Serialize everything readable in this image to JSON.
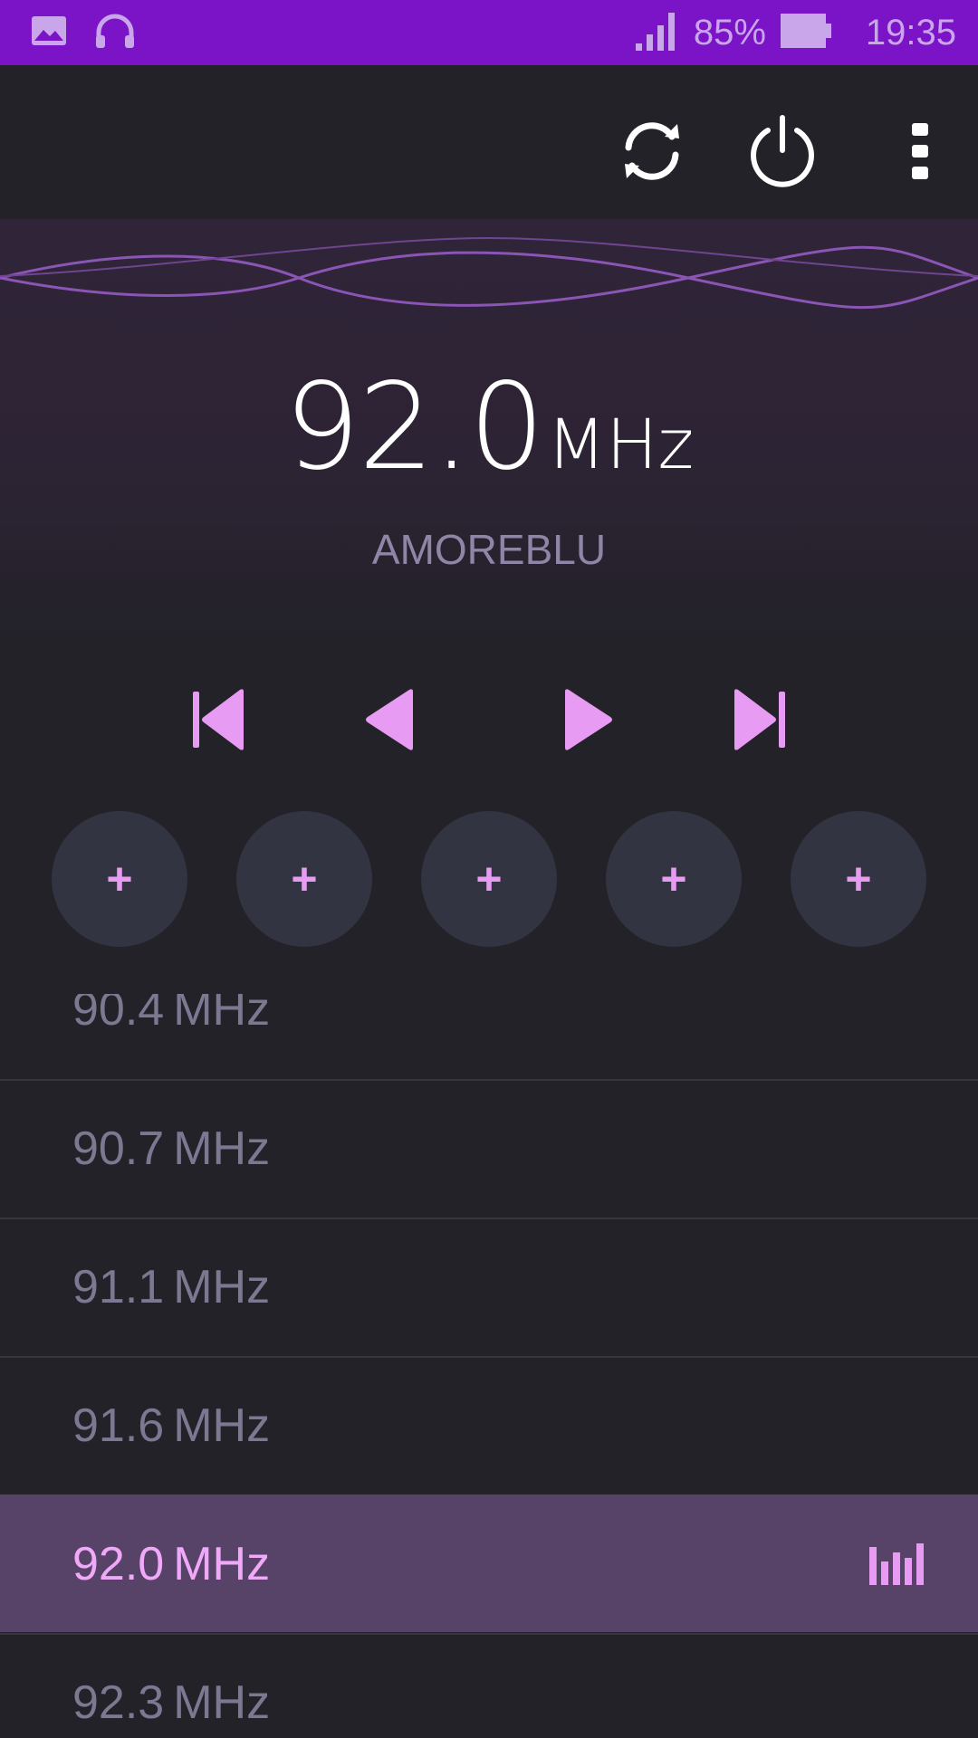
{
  "status_bar": {
    "battery": "85%",
    "time": "19:35",
    "icons": [
      "gallery-icon",
      "headphones-icon",
      "signal-icon",
      "battery-icon"
    ]
  },
  "toolbar": {
    "icons": [
      "refresh-icon",
      "power-icon",
      "more-vertical-icon"
    ]
  },
  "tuner": {
    "frequency": "92.0",
    "unit": "MHz",
    "station_name": "AMOREBLU"
  },
  "transport": [
    "skip-previous-icon",
    "seek-back-icon",
    "seek-forward-icon",
    "skip-next-icon"
  ],
  "presets": [
    {
      "label": "+"
    },
    {
      "label": "+"
    },
    {
      "label": "+"
    },
    {
      "label": "+"
    },
    {
      "label": "+"
    }
  ],
  "stations": [
    {
      "freq": "90.4",
      "unit": "MHz"
    },
    {
      "freq": "90.7",
      "unit": "MHz"
    },
    {
      "freq": "91.1",
      "unit": "MHz"
    },
    {
      "freq": "91.6",
      "unit": "MHz"
    },
    {
      "freq": "92.0",
      "unit": "MHz",
      "active": true
    },
    {
      "freq": "92.3",
      "unit": "MHz"
    }
  ],
  "colors": {
    "status_bar": "#7a14c6",
    "accent": "#e89bf2",
    "active_row": "#574367",
    "background": "#222228"
  }
}
